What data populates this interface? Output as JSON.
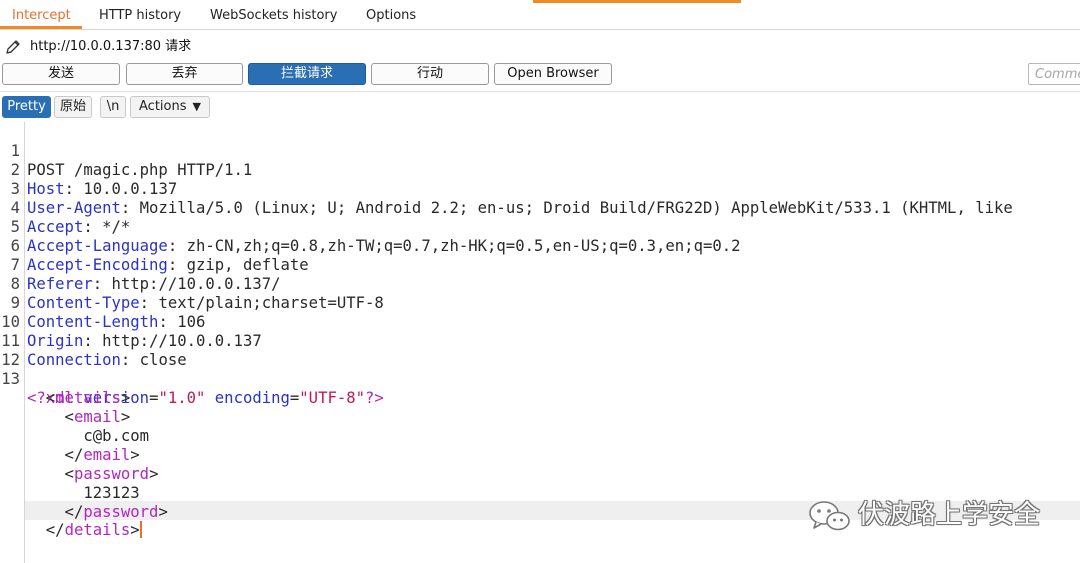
{
  "tabs": [
    {
      "label": "Intercept",
      "active": true
    },
    {
      "label": "HTTP history"
    },
    {
      "label": "WebSockets history"
    },
    {
      "label": "Options"
    }
  ],
  "target": {
    "url_label": "http://10.0.0.137:80 请求",
    "icon": "pencil-icon"
  },
  "actions": {
    "send": "发送",
    "drop": "丢弃",
    "intercept": "拦截请求",
    "action": "行动",
    "open_browser": "Open Browser"
  },
  "comment": {
    "placeholder": "Comment"
  },
  "editor_toolbar": {
    "pretty": "Pretty",
    "raw": "原始",
    "newline": "\\n",
    "actions": "Actions"
  },
  "request": {
    "line_numbers": [
      "1",
      "2",
      "3",
      "4",
      "5",
      "6",
      "7",
      "8",
      "9",
      "10",
      "11",
      "12",
      "13",
      "",
      "",
      "",
      "",
      "",
      "",
      "",
      ""
    ],
    "request_line": "POST /magic.php HTTP/1.1",
    "headers": [
      {
        "name": "Host",
        "value": "10.0.0.137"
      },
      {
        "name": "User-Agent",
        "value": "Mozilla/5.0 (Linux; U; Android 2.2; en-us; Droid Build/FRG22D) AppleWebKit/533.1 (KHTML, like"
      },
      {
        "name": "Accept",
        "value": "*/*"
      },
      {
        "name": "Accept-Language",
        "value": "zh-CN,zh;q=0.8,zh-TW;q=0.7,zh-HK;q=0.5,en-US;q=0.3,en;q=0.2"
      },
      {
        "name": "Accept-Encoding",
        "value": "gzip, deflate"
      },
      {
        "name": "Referer",
        "value": "http://10.0.0.137/"
      },
      {
        "name": "Content-Type",
        "value": "text/plain;charset=UTF-8"
      },
      {
        "name": "Content-Length",
        "value": "106"
      },
      {
        "name": "Origin",
        "value": "http://10.0.0.137"
      },
      {
        "name": "Connection",
        "value": "close"
      }
    ],
    "xml": {
      "decl_open": "<?xml",
      "version_attr": "version",
      "version_val": "\"1.0\"",
      "encoding_attr": "encoding",
      "encoding_val": "\"UTF-8\"",
      "decl_close": "?>",
      "root": "details",
      "email_tag": "email",
      "email_value": "c@b.com",
      "password_tag": "password",
      "password_value": "123123"
    }
  },
  "watermark": {
    "text": "伏波路上学安全",
    "icon": "wechat-icon"
  },
  "colors": {
    "accent": "#f08a24",
    "primary_button": "#2a6fb3",
    "header_key": "#2a32c8",
    "xml_tag": "#b325c1",
    "xml_value": "#c2185b"
  }
}
